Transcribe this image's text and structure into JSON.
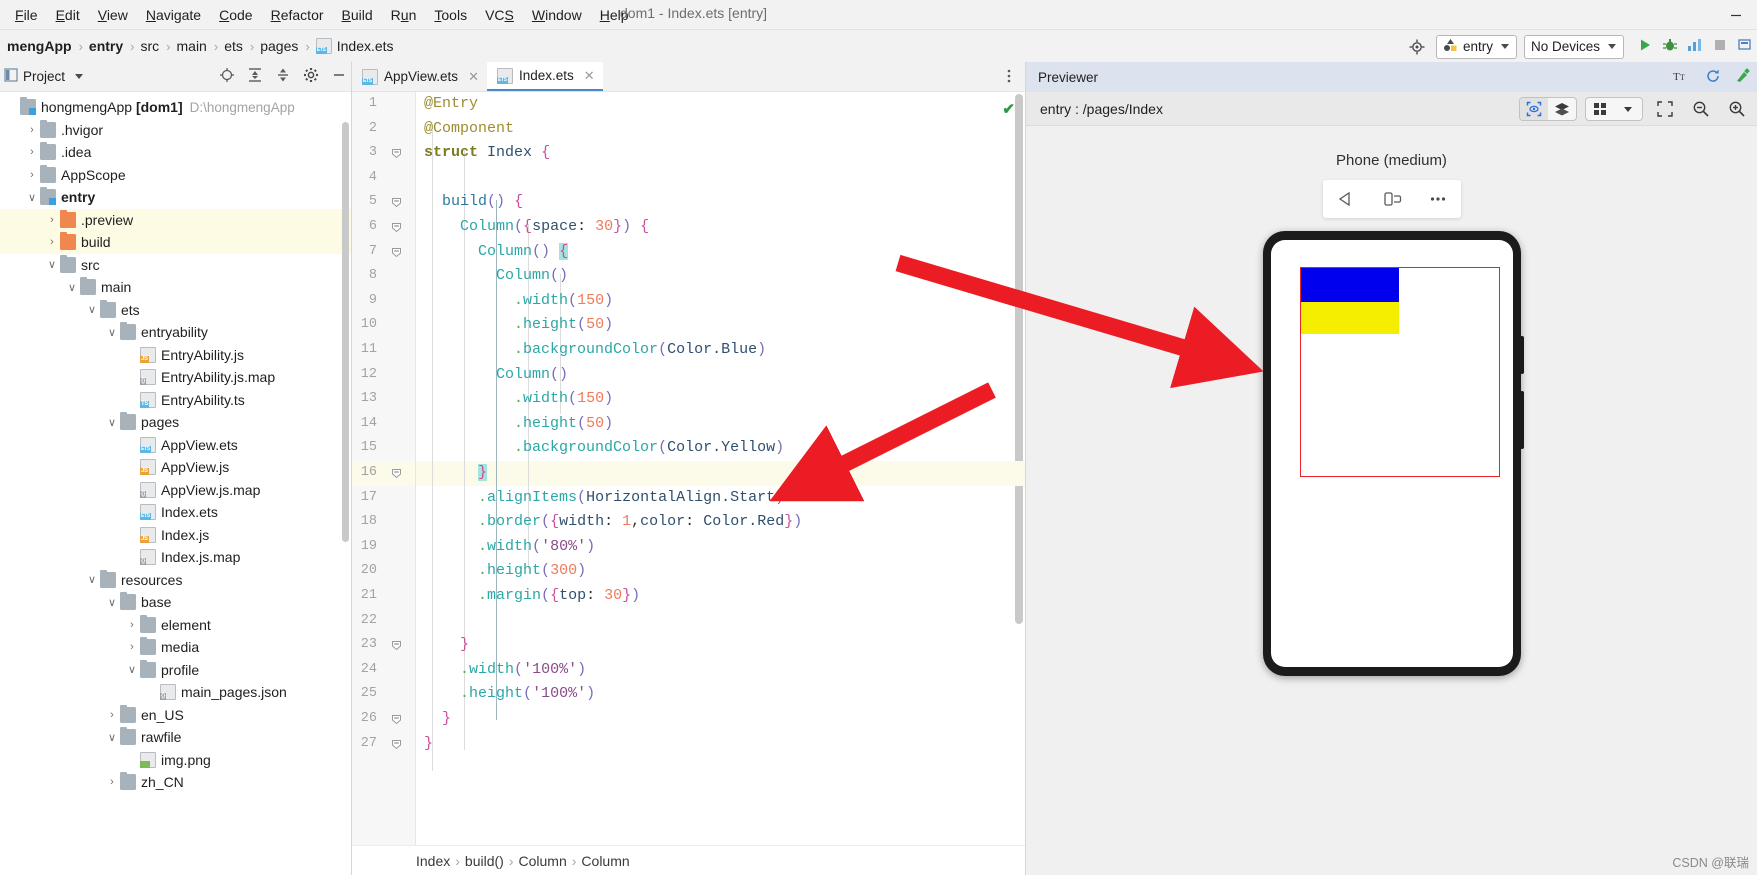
{
  "window": {
    "title": "dom1 - Index.ets [entry]",
    "minimize_label": "—"
  },
  "menubar": {
    "items": [
      {
        "pre": "",
        "mn": "F",
        "post": "ile"
      },
      {
        "pre": "",
        "mn": "E",
        "post": "dit"
      },
      {
        "pre": "",
        "mn": "V",
        "post": "iew"
      },
      {
        "pre": "",
        "mn": "N",
        "post": "avigate"
      },
      {
        "pre": "",
        "mn": "C",
        "post": "ode"
      },
      {
        "pre": "",
        "mn": "R",
        "post": "efactor"
      },
      {
        "pre": "",
        "mn": "B",
        "post": "uild"
      },
      {
        "pre": "R",
        "mn": "u",
        "post": "n"
      },
      {
        "pre": "",
        "mn": "T",
        "post": "ools"
      },
      {
        "pre": "VC",
        "mn": "S",
        "post": ""
      },
      {
        "pre": "",
        "mn": "W",
        "post": "indow"
      },
      {
        "pre": "",
        "mn": "H",
        "post": "elp"
      }
    ]
  },
  "navbar": {
    "crumbs": [
      "mengApp",
      "entry",
      "src",
      "main",
      "ets",
      "pages",
      "Index.ets"
    ],
    "separator": "›",
    "module_selector": "entry",
    "device_selector": "No Devices",
    "icons": {
      "target": "target-icon",
      "run": "run-icon",
      "debug": "debug-icon",
      "profile": "profiler-icon",
      "stop": "stop-icon",
      "more": "more-icon"
    }
  },
  "project_panel": {
    "title": "Project",
    "header_icons": [
      "locate-icon",
      "expand-all-icon",
      "collapse-all-icon",
      "gear-icon",
      "hide-icon"
    ],
    "tree": [
      {
        "depth": 0,
        "arrow": "",
        "icon": "module",
        "label": "hongmengApp [dom1]",
        "bold_part": "[dom1]",
        "hint": "D:\\hongmengApp",
        "highlight": false
      },
      {
        "depth": 1,
        "arrow": "›",
        "icon": "folder",
        "label": ".hvigor",
        "hint": "",
        "highlight": false
      },
      {
        "depth": 1,
        "arrow": "›",
        "icon": "folder",
        "label": ".idea",
        "hint": "",
        "highlight": false
      },
      {
        "depth": 1,
        "arrow": "›",
        "icon": "folder",
        "label": "AppScope",
        "hint": "",
        "highlight": false
      },
      {
        "depth": 1,
        "arrow": "∨",
        "icon": "module",
        "label": "entry",
        "hint": "",
        "highlight": false,
        "bold": true
      },
      {
        "depth": 2,
        "arrow": "›",
        "icon": "folder-orange",
        "label": ".preview",
        "hint": "",
        "highlight": true
      },
      {
        "depth": 2,
        "arrow": "›",
        "icon": "folder-orange",
        "label": "build",
        "hint": "",
        "highlight": true
      },
      {
        "depth": 2,
        "arrow": "∨",
        "icon": "folder",
        "label": "src",
        "hint": "",
        "highlight": false
      },
      {
        "depth": 3,
        "arrow": "∨",
        "icon": "folder",
        "label": "main",
        "hint": "",
        "highlight": false
      },
      {
        "depth": 4,
        "arrow": "∨",
        "icon": "folder",
        "label": "ets",
        "hint": "",
        "highlight": false
      },
      {
        "depth": 5,
        "arrow": "∨",
        "icon": "folder",
        "label": "entryability",
        "hint": "",
        "highlight": false
      },
      {
        "depth": 6,
        "arrow": "",
        "icon": "file-js",
        "label": "EntryAbility.js",
        "hint": "",
        "highlight": false
      },
      {
        "depth": 6,
        "arrow": "",
        "icon": "file-map",
        "label": "EntryAbility.js.map",
        "hint": "",
        "highlight": false
      },
      {
        "depth": 6,
        "arrow": "",
        "icon": "file-ts",
        "label": "EntryAbility.ts",
        "hint": "",
        "highlight": false
      },
      {
        "depth": 5,
        "arrow": "∨",
        "icon": "folder",
        "label": "pages",
        "hint": "",
        "highlight": false
      },
      {
        "depth": 6,
        "arrow": "",
        "icon": "file-ets",
        "label": "AppView.ets",
        "hint": "",
        "highlight": false
      },
      {
        "depth": 6,
        "arrow": "",
        "icon": "file-js",
        "label": "AppView.js",
        "hint": "",
        "highlight": false
      },
      {
        "depth": 6,
        "arrow": "",
        "icon": "file-map",
        "label": "AppView.js.map",
        "hint": "",
        "highlight": false
      },
      {
        "depth": 6,
        "arrow": "",
        "icon": "file-ets",
        "label": "Index.ets",
        "hint": "",
        "highlight": false
      },
      {
        "depth": 6,
        "arrow": "",
        "icon": "file-js",
        "label": "Index.js",
        "hint": "",
        "highlight": false
      },
      {
        "depth": 6,
        "arrow": "",
        "icon": "file-map",
        "label": "Index.js.map",
        "hint": "",
        "highlight": false
      },
      {
        "depth": 4,
        "arrow": "∨",
        "icon": "folder",
        "label": "resources",
        "hint": "",
        "highlight": false
      },
      {
        "depth": 5,
        "arrow": "∨",
        "icon": "folder",
        "label": "base",
        "hint": "",
        "highlight": false
      },
      {
        "depth": 6,
        "arrow": "›",
        "icon": "folder",
        "label": "element",
        "hint": "",
        "highlight": false
      },
      {
        "depth": 6,
        "arrow": "›",
        "icon": "folder",
        "label": "media",
        "hint": "",
        "highlight": false
      },
      {
        "depth": 6,
        "arrow": "∨",
        "icon": "folder",
        "label": "profile",
        "hint": "",
        "highlight": false
      },
      {
        "depth": 7,
        "arrow": "",
        "icon": "file-json",
        "label": "main_pages.json",
        "hint": "",
        "highlight": false
      },
      {
        "depth": 5,
        "arrow": "›",
        "icon": "folder",
        "label": "en_US",
        "hint": "",
        "highlight": false
      },
      {
        "depth": 5,
        "arrow": "∨",
        "icon": "folder",
        "label": "rawfile",
        "hint": "",
        "highlight": false
      },
      {
        "depth": 6,
        "arrow": "",
        "icon": "file-png",
        "label": "img.png",
        "hint": "",
        "highlight": false
      },
      {
        "depth": 5,
        "arrow": "›",
        "icon": "folder",
        "label": "zh_CN",
        "hint": "",
        "highlight": false
      }
    ]
  },
  "editor": {
    "tabs": [
      {
        "label": "AppView.ets",
        "active": false,
        "icon": "file-ets"
      },
      {
        "label": "Index.ets",
        "active": true,
        "icon": "file-ets"
      }
    ],
    "more_icon": "more-vertical-icon",
    "inspection_status": "✔",
    "caret_line": 16,
    "breadcrumb": [
      "Index",
      "build()",
      "Column",
      "Column"
    ],
    "lines": [
      {
        "n": 1,
        "fold": "",
        "html": "<span class='k-ann'>@Entry</span>"
      },
      {
        "n": 2,
        "fold": "",
        "html": "<span class='k-ann'>@Component</span>"
      },
      {
        "n": 3,
        "fold": "-",
        "html": "<span class='k-kw'>struct</span> <span class='k-type'>Index</span> <span class='k-br'>{</span>"
      },
      {
        "n": 4,
        "fold": "",
        "html": ""
      },
      {
        "n": 5,
        "fold": "-",
        "html": "  <span class='k-fn'>build</span><span class='k-par'>()</span> <span class='k-br'>{</span>"
      },
      {
        "n": 6,
        "fold": "-",
        "html": "    <span class='k-comp'>Column</span><span class='k-par'>(</span><span class='k-br'>{</span><span class='k-prop'>space</span><span class='k-plain'>:</span> <span class='k-num'>30</span><span class='k-br'>}</span><span class='k-par'>)</span> <span class='k-br'>{</span>"
      },
      {
        "n": 7,
        "fold": "-",
        "html": "      <span class='k-comp'>Column</span><span class='k-par'>()</span> <span class='k-br brace-hl'>{</span>"
      },
      {
        "n": 8,
        "fold": "",
        "html": "        <span class='k-comp'>Column</span><span class='k-par'>()</span>"
      },
      {
        "n": 9,
        "fold": "",
        "html": "          <span class='k-dot'>.</span><span class='k-comp'>width</span><span class='k-par'>(</span><span class='k-num'>150</span><span class='k-par'>)</span>"
      },
      {
        "n": 10,
        "fold": "",
        "html": "          <span class='k-dot'>.</span><span class='k-comp'>height</span><span class='k-par'>(</span><span class='k-num'>50</span><span class='k-par'>)</span>"
      },
      {
        "n": 11,
        "fold": "",
        "html": "          <span class='k-dot'>.</span><span class='k-comp'>backgroundColor</span><span class='k-par'>(</span><span class='k-prop'>Color.Blue</span><span class='k-par'>)</span>"
      },
      {
        "n": 12,
        "fold": "",
        "html": "        <span class='k-comp'>Column</span><span class='k-par'>()</span>"
      },
      {
        "n": 13,
        "fold": "",
        "html": "          <span class='k-dot'>.</span><span class='k-comp'>width</span><span class='k-par'>(</span><span class='k-num'>150</span><span class='k-par'>)</span>"
      },
      {
        "n": 14,
        "fold": "",
        "html": "          <span class='k-dot'>.</span><span class='k-comp'>height</span><span class='k-par'>(</span><span class='k-num'>50</span><span class='k-par'>)</span>"
      },
      {
        "n": 15,
        "fold": "",
        "html": "          <span class='k-dot'>.</span><span class='k-comp'>backgroundColor</span><span class='k-par'>(</span><span class='k-prop'>Color.Yellow</span><span class='k-par'>)</span>"
      },
      {
        "n": 16,
        "fold": "-",
        "html": "      <span class='k-br brace-hl'>}</span>"
      },
      {
        "n": 17,
        "fold": "",
        "html": "      <span class='k-dot'>.</span><span class='k-comp'>alignItems</span><span class='k-par'>(</span><span class='k-prop'>HorizontalAlign.Start</span><span class='k-par'>)</span>"
      },
      {
        "n": 18,
        "fold": "",
        "html": "      <span class='k-dot'>.</span><span class='k-comp'>border</span><span class='k-par'>(</span><span class='k-br'>{</span><span class='k-prop'>width</span><span class='k-plain'>:</span> <span class='k-num'>1</span><span class='k-plain'>,</span><span class='k-prop'>color</span><span class='k-plain'>:</span> <span class='k-prop'>Color.Red</span><span class='k-br'>}</span><span class='k-par'>)</span>"
      },
      {
        "n": 19,
        "fold": "",
        "html": "      <span class='k-dot'>.</span><span class='k-comp'>width</span><span class='k-par'>(</span><span class='k-str'>'80%'</span><span class='k-par'>)</span>"
      },
      {
        "n": 20,
        "fold": "",
        "html": "      <span class='k-dot'>.</span><span class='k-comp'>height</span><span class='k-par'>(</span><span class='k-num'>300</span><span class='k-par'>)</span>"
      },
      {
        "n": 21,
        "fold": "",
        "html": "      <span class='k-dot'>.</span><span class='k-comp'>margin</span><span class='k-par'>(</span><span class='k-br'>{</span><span class='k-prop'>top</span><span class='k-plain'>:</span> <span class='k-num'>30</span><span class='k-br'>}</span><span class='k-par'>)</span>"
      },
      {
        "n": 22,
        "fold": "",
        "html": ""
      },
      {
        "n": 23,
        "fold": "-",
        "html": "    <span class='k-br'>}</span>"
      },
      {
        "n": 24,
        "fold": "",
        "html": "    <span class='k-dot'>.</span><span class='k-comp'>width</span><span class='k-par'>(</span><span class='k-str'>'100%'</span><span class='k-par'>)</span>"
      },
      {
        "n": 25,
        "fold": "",
        "html": "    <span class='k-dot'>.</span><span class='k-comp'>height</span><span class='k-par'>(</span><span class='k-str'>'100%'</span><span class='k-par'>)</span>"
      },
      {
        "n": 26,
        "fold": "-",
        "html": "  <span class='k-br'>}</span>"
      },
      {
        "n": 27,
        "fold": "-",
        "html": "<span class='k-br'>}</span>"
      }
    ]
  },
  "previewer": {
    "title": "Previewer",
    "route": "entry : /pages/Index",
    "device_name": "Phone (medium)",
    "device_toolbar": [
      "back-icon",
      "rotate-icon",
      "more-icon"
    ],
    "view_buttons": [
      "inspector-icon",
      "layers-icon"
    ],
    "right_buttons": [
      "grid-icon",
      "chevron-down-icon",
      "fit-icon",
      "zoom-out-icon",
      "zoom-in-icon"
    ],
    "render": {
      "border_color": "#e8212b",
      "blue_color": "#0000ee",
      "yellow_color": "#f6ee00"
    }
  },
  "annotations": {
    "arrow_color": "#ec1c24",
    "arrow_count": 2
  },
  "watermark": "CSDN @联瑞"
}
